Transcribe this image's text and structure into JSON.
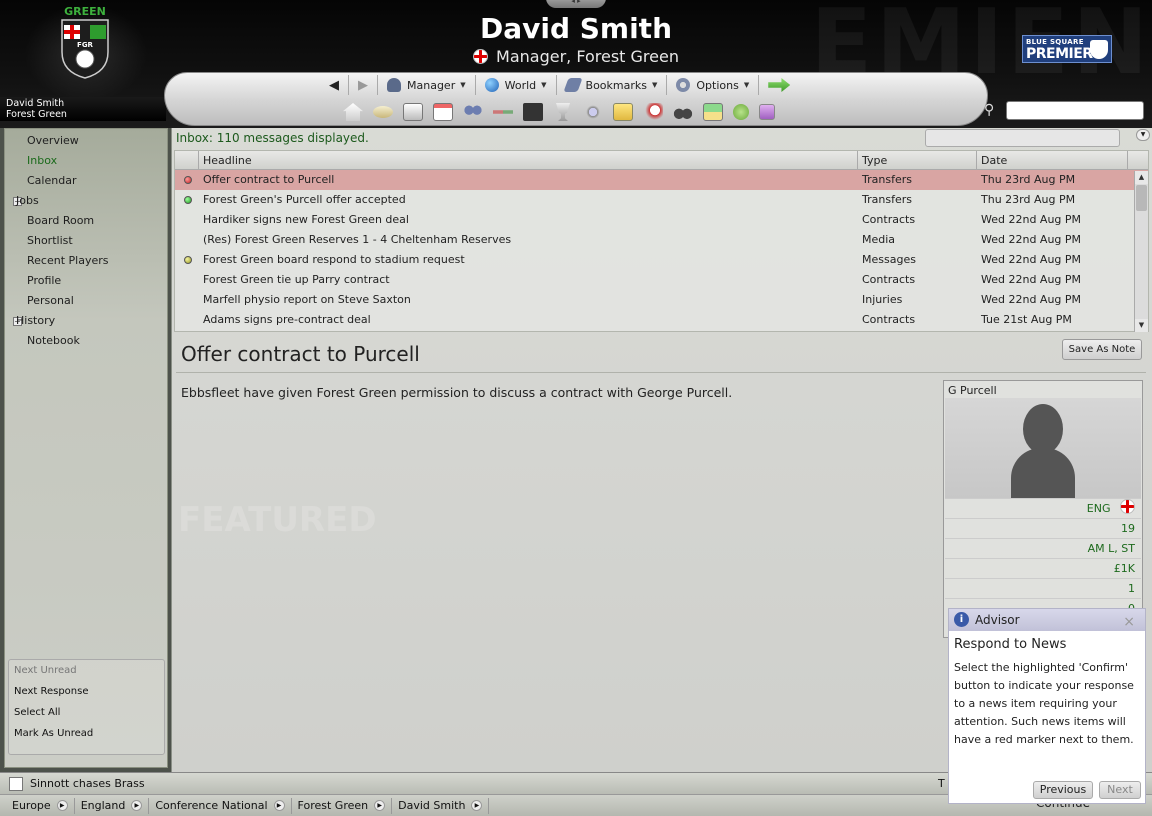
{
  "header": {
    "manager_name": "David Smith",
    "role": "Manager, Forest Green",
    "crest_text": "GREEN",
    "crest_abbrev": "FGR",
    "league_small": "BLUE SQUARE",
    "league_big": "PREMIER",
    "user_name": "David Smith",
    "user_club": "Forest Green"
  },
  "nav": {
    "back_icon": "back-arrow-icon",
    "forward_icon": "forward-arrow-icon",
    "manager_label": "Manager",
    "world_label": "World",
    "bookmarks_label": "Bookmarks",
    "options_label": "Options",
    "go_icon": "green-arrow-icon",
    "search_value": ""
  },
  "sidebar": {
    "items": [
      {
        "label": "Overview"
      },
      {
        "label": "Inbox"
      },
      {
        "label": "Calendar"
      },
      {
        "label": "Jobs"
      },
      {
        "label": "Board Room"
      },
      {
        "label": "Shortlist"
      },
      {
        "label": "Recent Players"
      },
      {
        "label": "Profile"
      },
      {
        "label": "Personal"
      },
      {
        "label": "History"
      },
      {
        "label": "Notebook"
      }
    ],
    "actions": [
      {
        "label": "Next Unread"
      },
      {
        "label": "Next Response"
      },
      {
        "label": "Select All"
      },
      {
        "label": "Mark As Unread"
      }
    ]
  },
  "inbox": {
    "status": "Inbox: 110 messages displayed.",
    "search_value": "",
    "columns": [
      "Headline",
      "Type",
      "Date"
    ],
    "messages": [
      {
        "headline": "Offer contract to Purcell",
        "type": "Transfers",
        "date": "Thu 23rd Aug PM",
        "marker": "red"
      },
      {
        "headline": "Forest Green's Purcell offer accepted",
        "type": "Transfers",
        "date": "Thu 23rd Aug PM",
        "marker": "green"
      },
      {
        "headline": "Hardiker signs new Forest Green deal",
        "type": "Contracts",
        "date": "Wed 22nd Aug PM",
        "marker": ""
      },
      {
        "headline": "(Res) Forest Green Reserves 1 - 4 Cheltenham Reserves",
        "type": "Media",
        "date": "Wed 22nd Aug PM",
        "marker": ""
      },
      {
        "headline": "Forest Green board respond to stadium request",
        "type": "Messages",
        "date": "Wed 22nd Aug PM",
        "marker": "yellow"
      },
      {
        "headline": "Forest Green tie up Parry contract",
        "type": "Contracts",
        "date": "Wed 22nd Aug PM",
        "marker": ""
      },
      {
        "headline": "Marfell physio report on Steve Saxton",
        "type": "Injuries",
        "date": "Wed 22nd Aug PM",
        "marker": ""
      },
      {
        "headline": "Adams signs pre-contract deal",
        "type": "Contracts",
        "date": "Tue 21st Aug PM",
        "marker": ""
      }
    ]
  },
  "detail": {
    "title": "Offer contract to Purcell",
    "save_note_label": "Save As Note",
    "body": "Ebbsfleet have given Forest Green permission to discuss a contract with George Purcell."
  },
  "player": {
    "name": "G Purcell",
    "nationality": "ENG",
    "age": "19",
    "position": "AM L, ST",
    "value": "£1K",
    "stat5": "1",
    "stat6": "0"
  },
  "advisor": {
    "header": "Advisor",
    "title": "Respond to News",
    "text": "Select the highlighted 'Confirm' button to indicate your response to a news item requiring your attention. Such news items will have a red marker next to them.",
    "prev_label": "Previous",
    "next_label": "Next"
  },
  "ticker": {
    "text": "Sinnott chases Brass",
    "tail": "T"
  },
  "breadcrumb": [
    {
      "label": "Europe"
    },
    {
      "label": "England"
    },
    {
      "label": "Conference National"
    },
    {
      "label": "Forest Green"
    },
    {
      "label": "David Smith"
    }
  ],
  "continue_label": "Continue",
  "colors": {
    "selected_row": "#d9a5a3",
    "accent_green": "#1b6a1b",
    "advisor_header": "#c1c1d8"
  }
}
